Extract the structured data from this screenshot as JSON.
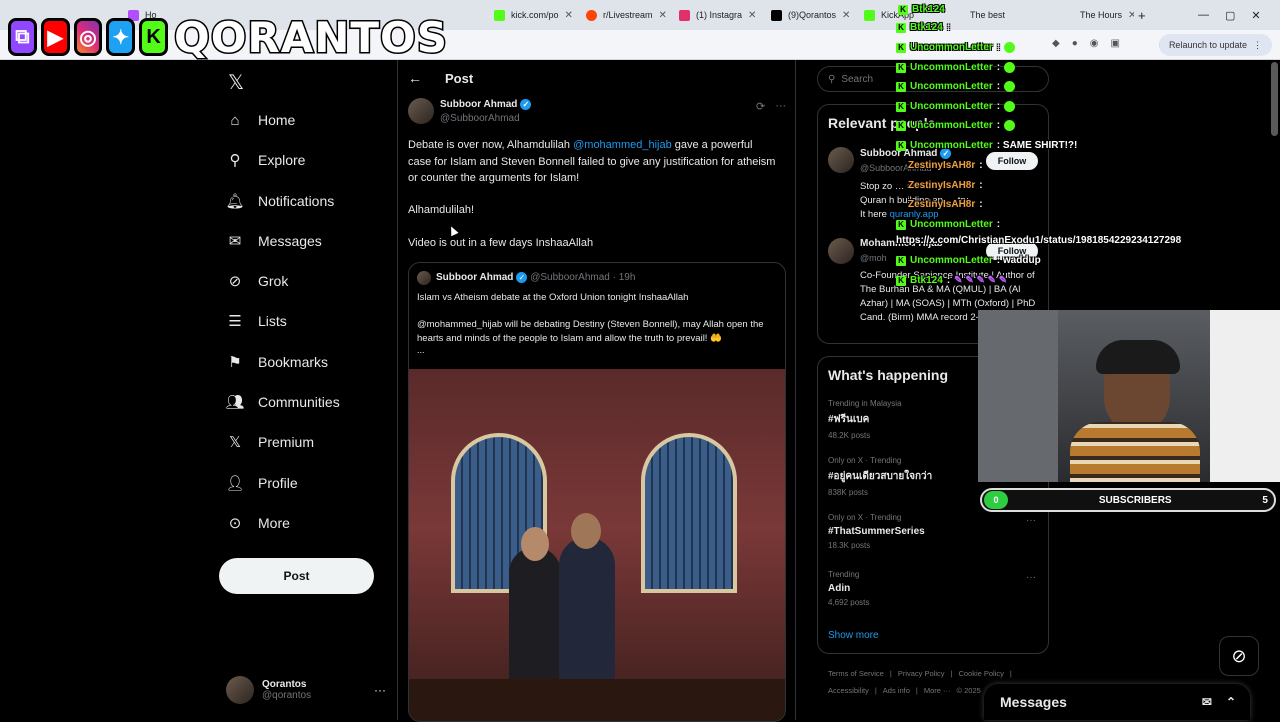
{
  "browser": {
    "tabs": [
      {
        "label": "Ho",
        "color": "#b14fff"
      },
      {
        "label": "kick.com/po",
        "color": "#53fc18"
      },
      {
        "label": "r/Livestream",
        "color": "#ff4500"
      },
      {
        "label": "(1) Instagra",
        "color": "#e1306c"
      },
      {
        "label": "(9)Qorantos",
        "color": "#000000"
      },
      {
        "label": "KickApp",
        "color": "#53fc18"
      },
      {
        "label": "The best",
        "color": "#888888"
      },
      {
        "label": "The Hours",
        "color": "#888888"
      }
    ],
    "new_tab": "+",
    "relaunch_label": "Relaunch to update"
  },
  "overlay": {
    "brand": "QORANTOS"
  },
  "nav": {
    "items": [
      {
        "label": "Home",
        "icon": "home-icon"
      },
      {
        "label": "Explore",
        "icon": "search-icon"
      },
      {
        "label": "Notifications",
        "icon": "bell-icon"
      },
      {
        "label": "Messages",
        "icon": "mail-icon"
      },
      {
        "label": "Grok",
        "icon": "grok-icon"
      },
      {
        "label": "Lists",
        "icon": "list-icon"
      },
      {
        "label": "Bookmarks",
        "icon": "bookmark-icon"
      },
      {
        "label": "Communities",
        "icon": "people-icon"
      },
      {
        "label": "Premium",
        "icon": "x-icon"
      },
      {
        "label": "Profile",
        "icon": "person-icon"
      },
      {
        "label": "More",
        "icon": "more-icon"
      }
    ],
    "post_label": "Post",
    "account_name": "Qorantos",
    "account_handle": "@qorantos",
    "account_more": "···"
  },
  "main": {
    "header": "Post",
    "author_name": "Subboor Ahmad",
    "author_handle": "@SubboorAhmad",
    "text_pre": "Debate is over now, Alhamdulilah ",
    "mention": "@mohammed_hijab",
    "text_post": " gave a powerful case for Islam and Steven Bonnell failed to give any justification for atheism or counter the arguments for Islam!",
    "line2": "Alhamdulilah!",
    "line3": "Video is out in a few days InshaaAllah",
    "quote": {
      "author_name": "Subboor Ahmad",
      "author_handle": "@SubboorAhmad · 19h",
      "line1": "Islam vs Atheism debate at the Oxford Union tonight InshaaAllah",
      "line2": "@mohammed_hijab will be debating Destiny (Steven Bonnell), may Allah open the hearts and minds of the people to Islam and allow the truth to prevail! 🤲",
      "ellipsis": "..."
    }
  },
  "right": {
    "search_placeholder": "Search",
    "relevant_title": "Relevant people",
    "people": [
      {
        "name": "Subboor Ahmad",
        "handle": "@SubboorAhmad",
        "bio_a": "Stop zo",
        "bio_b": "da",
        "bio_c": "he",
        "bio_d": "Quran h",
        "bio_e": "building ap",
        "bio_f": "try",
        "bio_g": "It here",
        "bio_link": "quranly.app",
        "follow": "Follow"
      },
      {
        "name": "Mohammed Hijab",
        "handle": "@moh",
        "bio": "Co-Founder Sapience Institute | Author of The Burhan BA & MA (QMUL) | BA (Al Azhar) | MA (SOAS) | MTh (Oxford) | PhD Cand. (Birm) MMA record 2-0",
        "follow": "Follow"
      }
    ],
    "happening_title": "What's happening",
    "trends": [
      {
        "meta": "Trending in Malaysia",
        "name": "#ฟรีนเบค",
        "count": "48.2K posts"
      },
      {
        "meta": "Only on X · Trending",
        "name": "#อยู่คนเดียวสบายใจกว่า",
        "count": "838K posts"
      },
      {
        "meta": "Only on X · Trending",
        "name": "#ThatSummerSeries",
        "count": "18.3K posts"
      },
      {
        "meta": "Trending",
        "name": "Adin",
        "count": "4,692 posts"
      }
    ],
    "show_more": "Show more",
    "footer_links": [
      "Terms of Service",
      "|",
      "Privacy Policy",
      "|",
      "Cookie Policy",
      "|"
    ],
    "footer_links2": [
      "Accessibility",
      "|",
      "Ads info",
      "|",
      "More ···",
      "© 2025"
    ]
  },
  "chat": [
    {
      "user": "Btk124",
      "msg": ""
    },
    {
      "user": "Btk124",
      "msg": ":"
    },
    {
      "user": "UncommonLetter",
      "msg": ":"
    },
    {
      "user": "UncommonLetter",
      "msg": ":"
    },
    {
      "user": "UncommonLetter",
      "msg": ":"
    },
    {
      "user": "UncommonLetter",
      "msg": ":"
    },
    {
      "user": "UncommonLetter",
      "msg": ":"
    },
    {
      "user": "UncommonLetter",
      "msg": ": SAME SHIRT!?!"
    },
    {
      "user": "ZestinyIsAH8r",
      "msg": ":"
    },
    {
      "user": "ZestinyIsAH8r",
      "msg": ":"
    },
    {
      "user": "ZestinyIsAH8r",
      "msg": ":"
    },
    {
      "user": "UncommonLetter",
      "msg": ":"
    },
    {
      "user": "",
      "msg": "https://x.com/ChristianExodu1/status/1981854229234127298"
    },
    {
      "user": "UncommonLetter",
      "msg": ": waddup"
    },
    {
      "user": "Btk124",
      "msg": ":"
    }
  ],
  "subs": {
    "current": "0",
    "label": "SUBSCRIBERS",
    "goal": "5"
  },
  "messages_label": "Messages",
  "colors": {
    "accent": "#1d9bf0",
    "kick": "#53fc18",
    "bg": "#000000"
  }
}
